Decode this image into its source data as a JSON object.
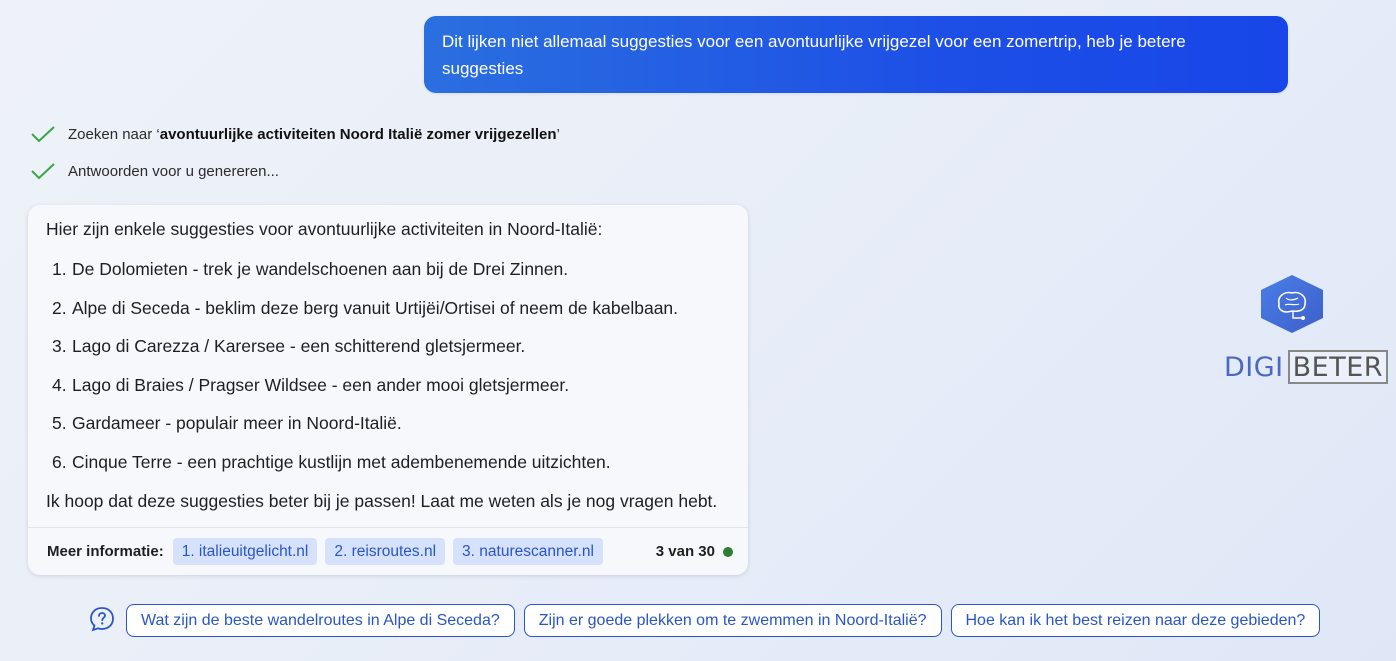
{
  "user_message": "Dit lijken niet allemaal suggesties voor een avontuurlijke vrijgezel voor een zomertrip, heb je betere suggesties",
  "steps": [
    {
      "prefix": "Zoeken naar ‘",
      "query": "avontuurlijke activiteiten Noord Italië zomer vrijgezellen",
      "suffix": "’"
    },
    {
      "text": "Antwoorden voor u genereren..."
    }
  ],
  "answer": {
    "intro": "Hier zijn enkele suggesties voor avontuurlijke activiteiten in Noord-Italië:",
    "items": [
      {
        "num": "1.",
        "text": "De Dolomieten - trek je wandelschoenen aan bij de Drei Zinnen."
      },
      {
        "num": "2.",
        "text": "Alpe di Seceda - beklim deze berg vanuit Urtijëi/Ortisei of neem de kabelbaan."
      },
      {
        "num": "3.",
        "text": "Lago di Carezza / Karersee - een schitterend gletsjermeer."
      },
      {
        "num": "4.",
        "text": "Lago di Braies / Pragser Wildsee - een ander mooi gletsjermeer."
      },
      {
        "num": "5.",
        "text": "Gardameer - populair meer in Noord-Italië."
      },
      {
        "num": "6.",
        "text": "Cinque Terre - een prachtige kustlijn met adembenemende uitzichten."
      }
    ],
    "outro": "Ik hoop dat deze suggesties beter bij je passen! Laat me weten als je nog vragen hebt.",
    "more_info_label": "Meer informatie:",
    "sources": [
      "1. italieuitgelicht.nl",
      "2. reisroutes.nl",
      "3. naturescanner.nl"
    ],
    "counter": "3 van 30",
    "status_color": "#2e7d32"
  },
  "logo": {
    "part1": "DIGI",
    "part2": "BETER"
  },
  "suggestions": [
    "Wat zijn de beste wandelroutes in Alpe di Seceda?",
    "Zijn er goede plekken om te zwemmen in Noord-Italië?",
    "Hoe kan ik het best reizen naar deze gebieden?"
  ],
  "colors": {
    "user_bubble": "#1d4fe6",
    "accent": "#2a55c7",
    "check": "#3aa54a"
  }
}
